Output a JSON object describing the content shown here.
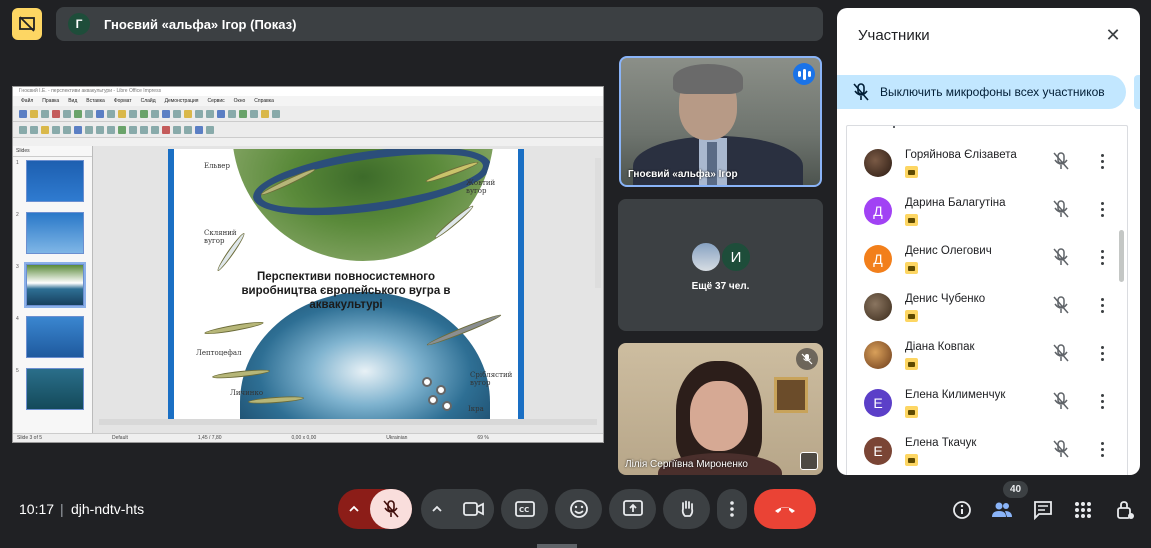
{
  "header": {
    "presenter_avatar_letter": "Г",
    "presentation_title": "Гноєвий «альфа» Ігор (Показ)"
  },
  "shared_screen": {
    "title_bar": "Гноєвий І.Е. - перспективи аквакультури - Libre Office Impress",
    "menu": [
      "Файл",
      "Правка",
      "Вид",
      "Вставка",
      "Формат",
      "Слайд",
      "Демонстрация",
      "Сервис",
      "Окно",
      "Справка"
    ],
    "slides_pane_label": "Slides",
    "thumb_numbers": [
      "1",
      "2",
      "3",
      "4",
      "5"
    ],
    "slide_title": "Перспективи повносистемного виробництва європейського вугра в аквакультурі",
    "slide_labels": {
      "eel_left": "Ельвер",
      "yellow_eel": "Жовтий вугор",
      "glass_eel": "Скляний вугор",
      "leptocephalus": "Лептоцефал",
      "larva": "Личинко",
      "silver_eel": "Сріблястий вугор",
      "roe": "Ікра"
    },
    "status": {
      "slide": "Slide 3 of 5",
      "layout": "Default",
      "position": "1,45 / 7,80",
      "size": "0,00 x 0,00",
      "language": "Ukrainian",
      "zoom": "69 %"
    }
  },
  "tiles": {
    "presenter_name": "Гноєвий «альфа» Ігор",
    "more_avatar_letter": "И",
    "more_label": "Ещё 37 чел.",
    "woman_name": "Лілія Сергіївна Мироненко"
  },
  "panel": {
    "title": "Участники",
    "mute_all": "Выключить микрофоны всех участников",
    "participants": [
      {
        "name": "Горяйнова Єлізавета",
        "letter": "",
        "color": "#3b2a22"
      },
      {
        "name": "Дарина Балагутіна",
        "letter": "Д",
        "color": "#a142f4"
      },
      {
        "name": "Денис Олегович",
        "letter": "Д",
        "color": "#f27f1b"
      },
      {
        "name": "Денис Чубенко",
        "letter": "",
        "color": "#4a3a2a"
      },
      {
        "name": "Діана Ковпак",
        "letter": "",
        "color": "#b06a2a"
      },
      {
        "name": "Елена Килименчук",
        "letter": "Е",
        "color": "#5b3fc8"
      },
      {
        "name": "Елена Ткачук",
        "letter": "Е",
        "color": "#7a4535"
      }
    ]
  },
  "bottom": {
    "time": "10:17",
    "separator": "|",
    "meeting_code": "djh-ndtv-hts",
    "participants_count": "40"
  },
  "colors": {
    "background": "#202124",
    "hangup": "#ea4335",
    "mic_off_bg": "#f9dedc",
    "accent_blue": "#8ab4f8"
  }
}
